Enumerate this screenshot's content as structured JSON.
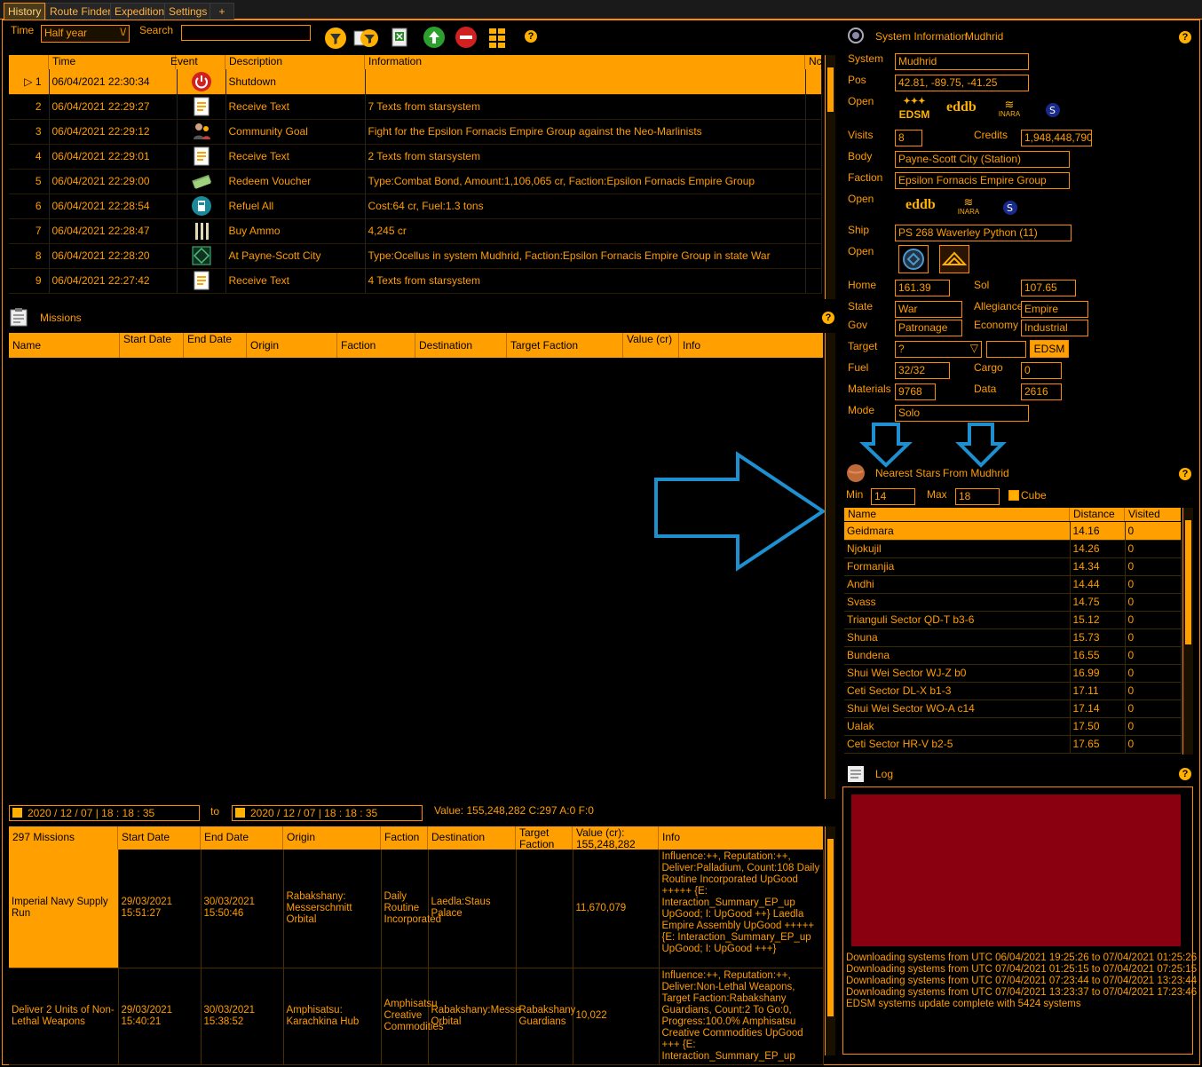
{
  "tabs": [
    "History",
    "Route Finder",
    "Expedition",
    "Settings",
    "+"
  ],
  "toolbar": {
    "time_label": "Time",
    "time_value": "Half year",
    "search_label": "Search",
    "search_value": ""
  },
  "history": {
    "headers": [
      "Time",
      "Event",
      "Description",
      "Information",
      "Nc"
    ],
    "rows": [
      {
        "n": "1",
        "time": "06/04/2021 22:30:34",
        "icon": "power-icon",
        "desc": "Shutdown",
        "info": ""
      },
      {
        "n": "2",
        "time": "06/04/2021 22:29:27",
        "icon": "text-icon",
        "desc": "Receive Text",
        "info": "7 Texts from starsystem"
      },
      {
        "n": "3",
        "time": "06/04/2021 22:29:12",
        "icon": "community-icon",
        "desc": "Community Goal",
        "info": "Fight for the Epsilon Fornacis Empire Group against the Neo-Marlinists"
      },
      {
        "n": "4",
        "time": "06/04/2021 22:29:01",
        "icon": "text-icon",
        "desc": "Receive Text",
        "info": "2 Texts from starsystem"
      },
      {
        "n": "5",
        "time": "06/04/2021 22:29:00",
        "icon": "voucher-icon",
        "desc": "Redeem Voucher",
        "info": "Type:Combat Bond, Amount:1,106,065 cr, Faction:Epsilon Fornacis Empire Group"
      },
      {
        "n": "6",
        "time": "06/04/2021 22:28:54",
        "icon": "fuel-icon",
        "desc": "Refuel All",
        "info": "Cost:64 cr, Fuel:1.3 tons"
      },
      {
        "n": "7",
        "time": "06/04/2021 22:28:47",
        "icon": "ammo-icon",
        "desc": "Buy Ammo",
        "info": "4,245 cr"
      },
      {
        "n": "8",
        "time": "06/04/2021 22:28:20",
        "icon": "docked-icon",
        "desc": "At Payne-Scott City",
        "info": "Type:Ocellus in system Mudhrid, Faction:Epsilon Fornacis Empire Group in state War"
      },
      {
        "n": "9",
        "time": "06/04/2021 22:27:42",
        "icon": "text-icon",
        "desc": "Receive Text",
        "info": "4 Texts from starsystem"
      }
    ]
  },
  "missions": {
    "title": "Missions",
    "headers": [
      "Name",
      "Start Date",
      "End Date",
      "Origin",
      "Faction",
      "Destination",
      "Target Faction",
      "Value (cr)",
      "Info"
    ]
  },
  "missions_bottom": {
    "from_date": "2020 / 12 / 07  | 18 : 18 : 35",
    "to_label": "to",
    "to_date": "2020 / 12 / 07  | 18 : 18 : 35",
    "value_text": "Value: 155,248,282 C:297 A:0 F:0",
    "headers": [
      "297 Missions",
      "Start Date",
      "End Date",
      "Origin",
      "Faction",
      "Destination",
      "Target Faction",
      "Value (cr): 155,248,282",
      "Info"
    ],
    "rows": [
      {
        "name": "Imperial Navy Supply Run",
        "start": "29/03/2021 15:51:27",
        "end": "30/03/2021 15:50:46",
        "origin": "Rabakshany: Messerschmitt Orbital",
        "faction": "Daily Routine Incorporated",
        "dest": "Laedla:Staus Palace",
        "target": "",
        "value": "11,670,079",
        "info": "Influence:++, Reputation:++, Deliver:Palladium, Count:108 Daily Routine Incorporated UpGood +++++ {E: Interaction_Summary_EP_up UpGood; I: UpGood ++} Laedla Empire Assembly UpGood +++++ {E: Interaction_Summary_EP_up UpGood; I: UpGood +++}"
      },
      {
        "name": "Deliver 2 Units of Non-Lethal Weapons",
        "start": "29/03/2021 15:40:21",
        "end": "30/03/2021 15:38:52",
        "origin": "Amphisatsu: Karachkina Hub",
        "faction": "Amphisatsu Creative Commodities",
        "dest": "Rabakshany:Messe Orbital",
        "target": "Rabakshany Guardians",
        "value": "10,022",
        "info": "Influence:++, Reputation:++, Deliver:Non-Lethal Weapons, Target Faction:Rabakshany Guardians, Count:2 To Go:0, Progress:100.0% Amphisatsu Creative Commodities UpGood +++ {E: Interaction_Summary_EP_up"
      }
    ]
  },
  "sysinfo": {
    "title": "System Information",
    "system_name": "Mudhrid",
    "system_label": "System",
    "system": "Mudhrid",
    "pos_label": "Pos",
    "pos": "42.81, -89.75, -41.25",
    "open_label": "Open",
    "open_links": [
      "EDSM",
      "eddb",
      "INARA",
      "spansh"
    ],
    "visits_label": "Visits",
    "visits": "8",
    "credits_label": "Credits",
    "credits": "1,948,448,790",
    "body_label": "Body",
    "body": "Payne-Scott City (Station)",
    "faction_label": "Faction",
    "faction": "Epsilon Fornacis Empire Group",
    "open2_links": [
      "eddb",
      "INARA",
      "spansh"
    ],
    "ship_label": "Ship",
    "ship": "PS 268 Waverley Python (11)",
    "home_label": "Home",
    "home": "161.39",
    "sol_label": "Sol",
    "sol": "107.65",
    "state_label": "State",
    "state": "War",
    "allegiance_label": "Allegiance",
    "allegiance": "Empire",
    "gov_label": "Gov",
    "gov": "Patronage",
    "economy_label": "Economy",
    "economy": "Industrial",
    "target_label": "Target",
    "target": "?",
    "edsm_button": "EDSM",
    "fuel_label": "Fuel",
    "fuel": "32/32",
    "cargo_label": "Cargo",
    "cargo": "0",
    "materials_label": "Materials",
    "materials": "9768",
    "data_label": "Data",
    "data": "2616",
    "mode_label": "Mode",
    "mode": "Solo"
  },
  "nearest": {
    "title": "Nearest Stars",
    "from": "From Mudhrid",
    "min_label": "Min",
    "min": "14",
    "max_label": "Max",
    "max": "18",
    "cube_label": "Cube",
    "headers": [
      "Name",
      "Distance",
      "Visited"
    ],
    "rows": [
      [
        "Geidmara",
        "14.16",
        "0"
      ],
      [
        "Njokujil",
        "14.26",
        "0"
      ],
      [
        "Formanjia",
        "14.34",
        "0"
      ],
      [
        "Andhi",
        "14.44",
        "0"
      ],
      [
        "Svass",
        "14.75",
        "0"
      ],
      [
        "Trianguli Sector QD-T b3-6",
        "15.12",
        "0"
      ],
      [
        "Shuna",
        "15.73",
        "0"
      ],
      [
        "Bundena",
        "16.55",
        "0"
      ],
      [
        "Shui Wei Sector WJ-Z b0",
        "16.99",
        "0"
      ],
      [
        "Ceti Sector DL-X b1-3",
        "17.11",
        "0"
      ],
      [
        "Shui Wei Sector WO-A c14",
        "17.14",
        "0"
      ],
      [
        "Ualak",
        "17.50",
        "0"
      ],
      [
        "Ceti Sector HR-V b2-5",
        "17.65",
        "0"
      ]
    ]
  },
  "log": {
    "title": "Log",
    "lines": [
      "Downloading systems from UTC 06/04/2021 19:25:26 to 07/04/2021 01:25:26",
      "Downloading systems from UTC 07/04/2021 01:25:15 to 07/04/2021 07:25:15",
      "Downloading systems from UTC 07/04/2021 07:23:44 to 07/04/2021 13:23:44",
      "Downloading systems from UTC 07/04/2021 13:23:37 to 07/04/2021 17:23:46",
      "EDSM systems update complete with 5424 systems"
    ]
  },
  "colors": {
    "accent": "#ff9c00",
    "selection": "#ffa000",
    "annotation": "#1e90d0",
    "log_panel": "#8b0010"
  }
}
